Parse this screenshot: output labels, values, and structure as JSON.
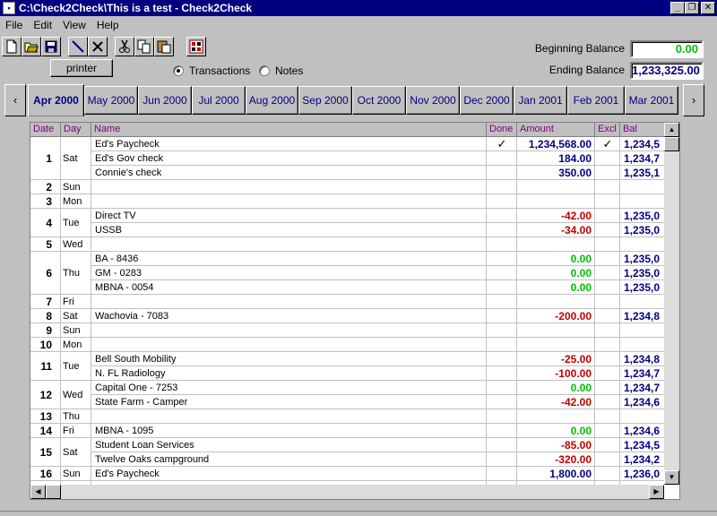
{
  "window": {
    "title": "C:\\Check2Check\\This is a test - Check2Check"
  },
  "menu": [
    "File",
    "Edit",
    "View",
    "Help"
  ],
  "toolbar": {
    "icons": [
      "new-file-icon",
      "open-folder-icon",
      "save-disk-icon",
      "pen-icon",
      "delete-x-icon",
      "cut-scissors-icon",
      "copy-icon",
      "paste-icon",
      "calculator-icon"
    ],
    "printer_label": "printer"
  },
  "view_mode": {
    "transactions_label": "Transactions",
    "notes_label": "Notes",
    "selected": "Transactions"
  },
  "balances": {
    "beginning_label": "Beginning Balance",
    "beginning_value": "0.00",
    "ending_label": "Ending Balance",
    "ending_value": "1,233,325.00"
  },
  "months": {
    "prev_label": "‹",
    "next_label": "›",
    "tabs": [
      "Apr 2000",
      "May 2000",
      "Jun 2000",
      "Jul 2000",
      "Aug 2000",
      "Sep 2000",
      "Oct 2000",
      "Nov 2000",
      "Dec 2000",
      "Jan 2001",
      "Feb 2001",
      "Mar 2001"
    ],
    "active": "Apr 2000"
  },
  "grid": {
    "headers": {
      "date": "Date",
      "day": "Day",
      "name": "Name",
      "done": "Done",
      "amount": "Amount",
      "excl": "Excl",
      "bal": "Bal"
    },
    "colors": {
      "positive": "#000080",
      "negative": "#c00000",
      "zero": "#00c000",
      "header_text": "#800080"
    },
    "days": [
      {
        "date": "1",
        "day": "Sat",
        "rows": [
          {
            "name": "Ed's Paycheck",
            "done": "✓",
            "amount": "1,234,568.00",
            "excl": "✓",
            "bal": "1,234,5",
            "sign": "positive"
          },
          {
            "name": "Ed's Gov check",
            "amount": "184.00",
            "bal": "1,234,7",
            "sign": "positive"
          },
          {
            "name": "Connie's check",
            "amount": "350.00",
            "bal": "1,235,1",
            "sign": "positive"
          }
        ]
      },
      {
        "date": "2",
        "day": "Sun",
        "rows": [
          {
            "name": ""
          }
        ]
      },
      {
        "date": "3",
        "day": "Mon",
        "rows": [
          {
            "name": ""
          }
        ]
      },
      {
        "date": "4",
        "day": "Tue",
        "rows": [
          {
            "name": "Direct TV",
            "amount": "-42.00",
            "bal": "1,235,0",
            "sign": "negative"
          },
          {
            "name": "USSB",
            "amount": "-34.00",
            "bal": "1,235,0",
            "sign": "negative"
          }
        ]
      },
      {
        "date": "5",
        "day": "Wed",
        "rows": [
          {
            "name": ""
          }
        ]
      },
      {
        "date": "6",
        "day": "Thu",
        "rows": [
          {
            "name": "BA - 8436",
            "amount": "0.00",
            "bal": "1,235,0",
            "sign": "zero"
          },
          {
            "name": "GM - 0283",
            "amount": "0.00",
            "bal": "1,235,0",
            "sign": "zero"
          },
          {
            "name": "MBNA - 0054",
            "amount": "0.00",
            "bal": "1,235,0",
            "sign": "zero"
          }
        ]
      },
      {
        "date": "7",
        "day": "Fri",
        "rows": [
          {
            "name": ""
          }
        ]
      },
      {
        "date": "8",
        "day": "Sat",
        "rows": [
          {
            "name": "Wachovia - 7083",
            "amount": "-200.00",
            "bal": "1,234,8",
            "sign": "negative"
          }
        ]
      },
      {
        "date": "9",
        "day": "Sun",
        "rows": [
          {
            "name": ""
          }
        ]
      },
      {
        "date": "10",
        "day": "Mon",
        "rows": [
          {
            "name": ""
          }
        ]
      },
      {
        "date": "11",
        "day": "Tue",
        "rows": [
          {
            "name": "Bell South Mobility",
            "amount": "-25.00",
            "bal": "1,234,8",
            "sign": "negative"
          },
          {
            "name": "N. FL Radiology",
            "amount": "-100.00",
            "bal": "1,234,7",
            "sign": "negative"
          }
        ]
      },
      {
        "date": "12",
        "day": "Wed",
        "rows": [
          {
            "name": "Capital One - 7253",
            "amount": "0.00",
            "bal": "1,234,7",
            "sign": "zero"
          },
          {
            "name": "State Farm - Camper",
            "amount": "-42.00",
            "bal": "1,234,6",
            "sign": "negative"
          }
        ]
      },
      {
        "date": "13",
        "day": "Thu",
        "rows": [
          {
            "name": ""
          }
        ]
      },
      {
        "date": "14",
        "day": "Fri",
        "rows": [
          {
            "name": "MBNA - 1095",
            "amount": "0.00",
            "bal": "1,234,6",
            "sign": "zero"
          }
        ]
      },
      {
        "date": "15",
        "day": "Sat",
        "rows": [
          {
            "name": "Student Loan Services",
            "amount": "-85.00",
            "bal": "1,234,5",
            "sign": "negative"
          },
          {
            "name": "Twelve Oaks campground",
            "amount": "-320.00",
            "bal": "1,234,2",
            "sign": "negative"
          }
        ]
      },
      {
        "date": "16",
        "day": "Sun",
        "rows": [
          {
            "name": "Ed's Paycheck",
            "amount": "1,800.00",
            "bal": "1,236,0",
            "sign": "positive"
          }
        ]
      }
    ]
  }
}
